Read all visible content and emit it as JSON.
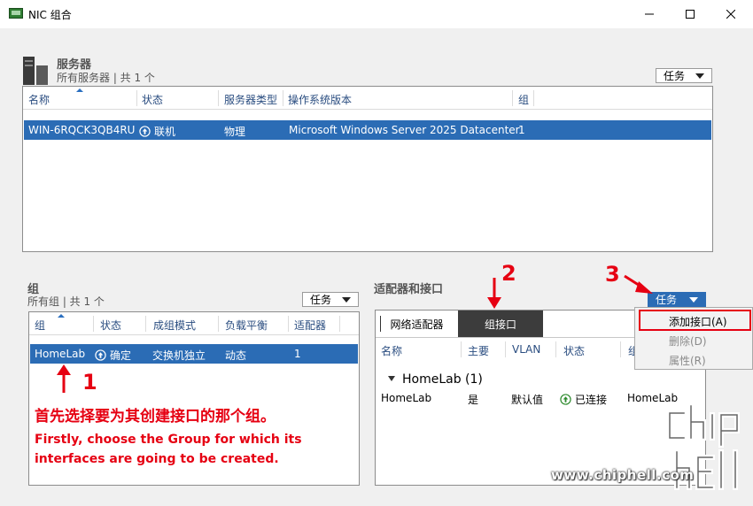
{
  "window": {
    "title": "NIC 组合"
  },
  "servers": {
    "title": "服务器",
    "subtitle": "所有服务器 | 共 1 个",
    "task_label": "任务",
    "columns": [
      "名称",
      "状态",
      "服务器类型",
      "操作系统版本",
      "组"
    ],
    "rows": [
      {
        "name": "WIN-6RQCK3QB4RU",
        "status": "联机",
        "type": "物理",
        "os": "Microsoft Windows Server 2025 Datacenter",
        "group": "1"
      }
    ]
  },
  "groups": {
    "title": "组",
    "subtitle": "所有组 | 共 1 个",
    "task_label": "任务",
    "columns": [
      "组",
      "状态",
      "成组模式",
      "负载平衡",
      "适配器"
    ],
    "rows": [
      {
        "group": "HomeLab",
        "status": "确定",
        "mode": "交换机独立",
        "balance": "动态",
        "adapters": "1"
      }
    ]
  },
  "adapters": {
    "title": "适配器和接口",
    "task_label": "任务",
    "tabs": [
      "网络适配器",
      "组接口"
    ],
    "columns": [
      "名称",
      "主要",
      "VLAN",
      "状态",
      "组"
    ],
    "group_header": "HomeLab (1)",
    "rows": [
      {
        "name": "HomeLab",
        "primary": "是",
        "vlan": "默认值",
        "status": "已连接",
        "team": "HomeLab"
      }
    ]
  },
  "context_menu": {
    "items": [
      {
        "label": "添加接口(A)",
        "enabled": true
      },
      {
        "label": "删除(D)",
        "enabled": false
      },
      {
        "label": "属性(R)",
        "enabled": false
      }
    ]
  },
  "annotations": {
    "step1": "1",
    "step2": "2",
    "step3": "3",
    "instruction_cn": "首先选择要为其创建接口的那个组。",
    "instruction_en": "Firstly, choose the Group for which its interfaces are going to be created."
  },
  "watermark": {
    "url": "www.chiphell.com",
    "logo_text": "chip hell"
  },
  "colors": {
    "selection": "#2b6cb5",
    "annotation": "#e60012",
    "header_text": "#2a4d80"
  }
}
